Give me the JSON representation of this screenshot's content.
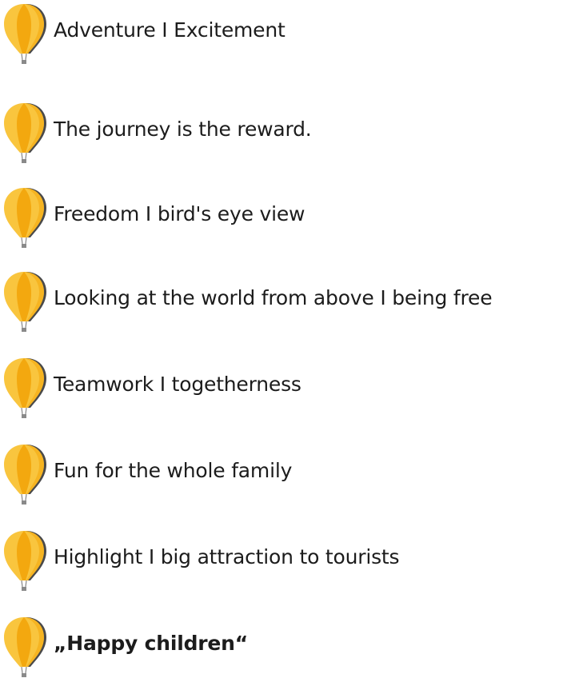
{
  "colors": {
    "balloon_light": "#F9C53E",
    "balloon_dark": "#F3A80F",
    "balloon_shadow": "#4A4A4A",
    "basket": "#8A8A8A",
    "text": "#1C1C1C"
  },
  "icon_name": "hot-air-balloon-icon",
  "items": [
    {
      "label": "Adventure I Excitement",
      "bold": false
    },
    {
      "label": "The journey is the reward.",
      "bold": false
    },
    {
      "label": "Freedom I bird's eye view",
      "bold": false
    },
    {
      "label": "Looking at the world from above I being free",
      "bold": false
    },
    {
      "label": "Teamwork I togetherness",
      "bold": false
    },
    {
      "label": "Fun for the whole family",
      "bold": false
    },
    {
      "label": "Highlight I big attraction to tourists",
      "bold": false
    },
    {
      "label": "„Happy children“",
      "bold": true
    }
  ]
}
